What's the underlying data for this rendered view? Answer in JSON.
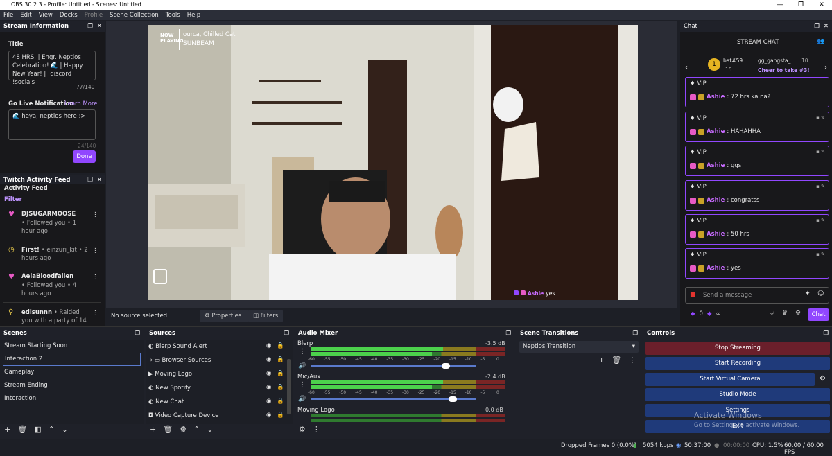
{
  "window": {
    "title": "OBS 30.2.3 - Profile: Untitled - Scenes: Untitled"
  },
  "menu": [
    "File",
    "Edit",
    "View",
    "Docks",
    "Profile",
    "Scene Collection",
    "Tools",
    "Help"
  ],
  "stream_info": {
    "header": "Stream Information",
    "title_label": "Title",
    "title_value": "48 HRS. | Engr. Neptios Celebration! 🌊 | Happy New Year! | !discord !socials",
    "title_count": "77/140",
    "golive_label": "Go Live Notification",
    "learn_more": "Learn More",
    "golive_value": "🌊 heya, neptios here :>",
    "golive_count": "24/140",
    "done": "Done"
  },
  "activity": {
    "header": "Twitch Activity Feed",
    "sub": "Activity Feed",
    "filter": "Filter",
    "items": [
      {
        "name": "DJSUGARMOOSE",
        "text": "• Followed you • 1 hour ago"
      },
      {
        "name": "First!",
        "text": "• einzuri_kit • 2 hours ago"
      },
      {
        "name": "AeiaBloodfallen",
        "text": "• Followed you • 4 hours ago"
      },
      {
        "name": "edisunnn",
        "text": "• Raided you with a party of 14"
      }
    ]
  },
  "preview": {
    "now_playing_label": "NOW PLAYING",
    "artist": "ourca, Chilled Cat",
    "song": "SUNBEAM",
    "overlay_user": "Ashie",
    "overlay_msg": "yes"
  },
  "source_bar": {
    "no_source": "No source selected",
    "properties": "Properties",
    "filters": "Filters"
  },
  "chat": {
    "header": "Chat",
    "title": "STREAM CHAT",
    "top1_name": "bat#59",
    "top1_count": "15",
    "top2_name": "gg_gangsta_",
    "top2_count": "10",
    "cheer": "Cheer to take #3!",
    "messages": [
      {
        "badge": "VIP",
        "user": "Ashie",
        "text": ": 72 hrs ka na?"
      },
      {
        "badge": "VIP",
        "user": "Ashie",
        "text": ": HAHAHHA"
      },
      {
        "badge": "VIP",
        "user": "Ashie",
        "text": ": ggs"
      },
      {
        "badge": "VIP",
        "user": "Ashie",
        "text": ": congratss"
      },
      {
        "badge": "VIP",
        "user": "Ashie",
        "text": ": 50 hrs"
      },
      {
        "badge": "VIP",
        "user": "Ashie",
        "text": ": yes"
      }
    ],
    "input_placeholder": "Send a message",
    "points": "0",
    "infinity": "∞",
    "chat_btn": "Chat"
  },
  "scenes": {
    "header": "Scenes",
    "items": [
      "Stream Starting Soon",
      "Interaction 2",
      "Gameplay",
      "Stream Ending",
      "Interaction"
    ]
  },
  "sources": {
    "header": "Sources",
    "items": [
      "Blerp Sound Alert",
      "Browser Sources",
      "Moving Logo",
      "New Spotify",
      "New Chat",
      "Video Capture Device"
    ]
  },
  "mixer": {
    "header": "Audio Mixer",
    "channels": [
      {
        "name": "Blerp",
        "db": "-3.5 dB",
        "level": 0.82
      },
      {
        "name": "Mic/Aux",
        "db": "-2.4 dB",
        "level": 0.86
      },
      {
        "name": "Moving Logo",
        "db": "0.0 dB",
        "level": 1.0
      }
    ],
    "ticks": [
      "-60",
      "-55",
      "-50",
      "-45",
      "-40",
      "-35",
      "-30",
      "-25",
      "-20",
      "-15",
      "-10",
      "-5",
      "0"
    ]
  },
  "transitions": {
    "header": "Scene Transitions",
    "selected": "Neptios Transition"
  },
  "controls": {
    "header": "Controls",
    "stop_streaming": "Stop Streaming",
    "start_recording": "Start Recording",
    "start_virtual": "Start Virtual Camera",
    "studio_mode": "Studio Mode",
    "settings": "Settings",
    "exit": "Exit"
  },
  "watermark": {
    "line1": "Activate Windows",
    "line2": "Go to Settings to activate Windows."
  },
  "status": {
    "dropped": "Dropped Frames 0 (0.0%)",
    "kbps": "5054 kbps",
    "stream_time": "50:37:00",
    "rec_time": "00:00:00",
    "cpu": "CPU: 1.5%",
    "fps": "60.00 / 60.00 FPS"
  },
  "colors": {
    "accent": "#9147ff",
    "stop": "#6b1f2b",
    "blue": "#1f3a7a"
  }
}
